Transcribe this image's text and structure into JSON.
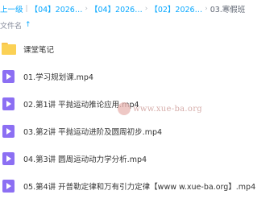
{
  "breadcrumb": {
    "back": "上一级",
    "crumbs": [
      "【04】2026…",
      "【04】2026…",
      "【02】2026…"
    ],
    "current": "03.寒假班"
  },
  "columns": {
    "name_label": "文件名"
  },
  "files": [
    {
      "name": "课堂笔记",
      "type": "folder"
    },
    {
      "name": "01.学习规划课.mp4",
      "type": "video"
    },
    {
      "name": "02.第1讲 平抛运动推论应用.mp4",
      "type": "video"
    },
    {
      "name": "03.第2讲 平抛运动进阶及圆周初步.mp4",
      "type": "video"
    },
    {
      "name": "04.第3讲 圆周运动动力学分析.mp4",
      "type": "video"
    },
    {
      "name": "05.第4讲 开普勒定律和万有引力定律【www w.xue-ba.org】.mp4",
      "type": "video"
    }
  ],
  "watermark": {
    "text": "www.xue-ba.org"
  },
  "colors": {
    "link": "#06a7ff",
    "folder": "#fbd155",
    "video": "#8c6ff3"
  }
}
